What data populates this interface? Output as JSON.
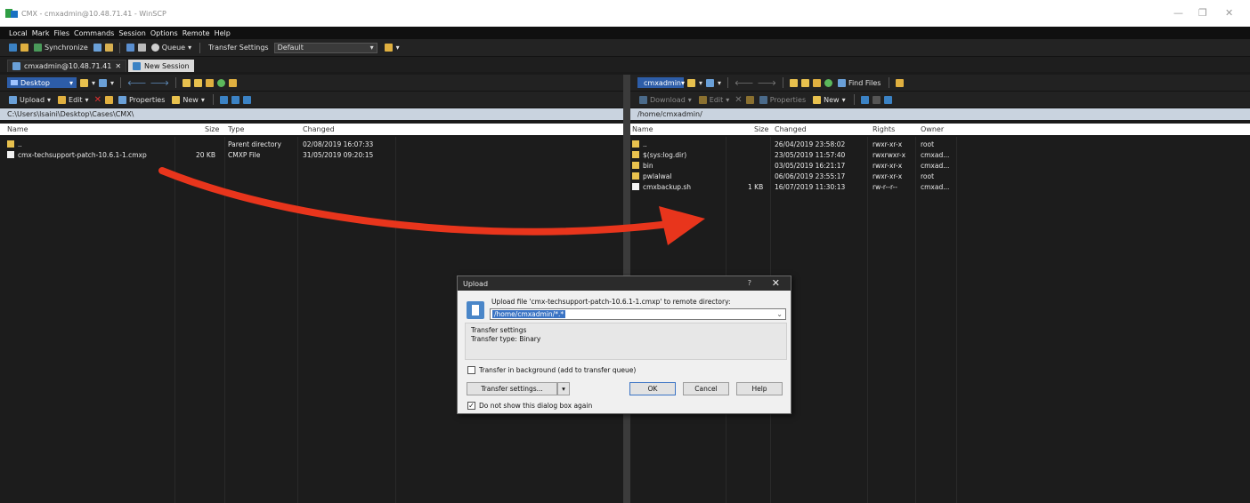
{
  "window": {
    "title": "CMX - cmxadmin@10.48.71.41 - WinSCP",
    "minimize": "—",
    "maximize": "❐",
    "close": "✕"
  },
  "menu": [
    "Local",
    "Mark",
    "Files",
    "Commands",
    "Session",
    "Options",
    "Remote",
    "Help"
  ],
  "toolbar": {
    "synchronize": "Synchronize",
    "queue": "Queue",
    "transfer_settings_label": "Transfer Settings",
    "transfer_settings_value": "Default"
  },
  "tabs": {
    "session": "cmxadmin@10.48.71.41",
    "session_close": "✕",
    "new_session": "New Session"
  },
  "local": {
    "location": "Desktop",
    "upload": "Upload",
    "edit": "Edit",
    "properties": "Properties",
    "new": "New",
    "path": "C:\\Users\\lsaini\\Desktop\\Cases\\CMX\\",
    "columns": {
      "name": "Name",
      "size": "Size",
      "type": "Type",
      "changed": "Changed"
    },
    "rows": [
      {
        "name": "..",
        "size": "",
        "type": "Parent directory",
        "changed": "02/08/2019 16:07:33",
        "icon": "up"
      },
      {
        "name": "cmx-techsupport-patch-10.6.1-1.cmxp",
        "size": "20 KB",
        "type": "CMXP File",
        "changed": "31/05/2019 09:20:15",
        "icon": "file"
      }
    ]
  },
  "remote": {
    "location": "cmxadmin",
    "download": "Download",
    "edit": "Edit",
    "properties": "Properties",
    "new": "New",
    "find_files": "Find Files",
    "path": "/home/cmxadmin/",
    "columns": {
      "name": "Name",
      "size": "Size",
      "changed": "Changed",
      "rights": "Rights",
      "owner": "Owner"
    },
    "rows": [
      {
        "name": "..",
        "size": "",
        "changed": "26/04/2019 23:58:02",
        "rights": "rwxr-xr-x",
        "owner": "root",
        "icon": "up"
      },
      {
        "name": "$(sys:log.dir)",
        "size": "",
        "changed": "23/05/2019 11:57:40",
        "rights": "rwxrwxr-x",
        "owner": "cmxad...",
        "icon": "folder"
      },
      {
        "name": "bin",
        "size": "",
        "changed": "03/05/2019 16:21:17",
        "rights": "rwxr-xr-x",
        "owner": "cmxad...",
        "icon": "folder"
      },
      {
        "name": "pwlalwal",
        "size": "",
        "changed": "06/06/2019 23:55:17",
        "rights": "rwxr-xr-x",
        "owner": "root",
        "icon": "folder"
      },
      {
        "name": "cmxbackup.sh",
        "size": "1 KB",
        "changed": "16/07/2019 11:30:13",
        "rights": "rw-r--r--",
        "owner": "cmxad...",
        "icon": "file"
      }
    ]
  },
  "dialog": {
    "title": "Upload",
    "help_glyph": "?",
    "close_glyph": "✕",
    "prompt": "Upload file 'cmx-techsupport-patch-10.6.1-1.cmxp' to remote directory:",
    "destination": "/home/cmxadmin/*.*",
    "settings_heading": "Transfer settings",
    "transfer_type": "Transfer type: Binary",
    "background_label": "Transfer in background (add to transfer queue)",
    "background_checked": false,
    "settings_button": "Transfer settings...",
    "ok": "OK",
    "cancel": "Cancel",
    "help": "Help",
    "dont_show_label": "Do not show this dialog box again",
    "dont_show_checked": true
  },
  "colors": {
    "annotation_arrow": "#e8351c",
    "path_bar": "#c9d3df",
    "selection": "#3b74c4"
  }
}
